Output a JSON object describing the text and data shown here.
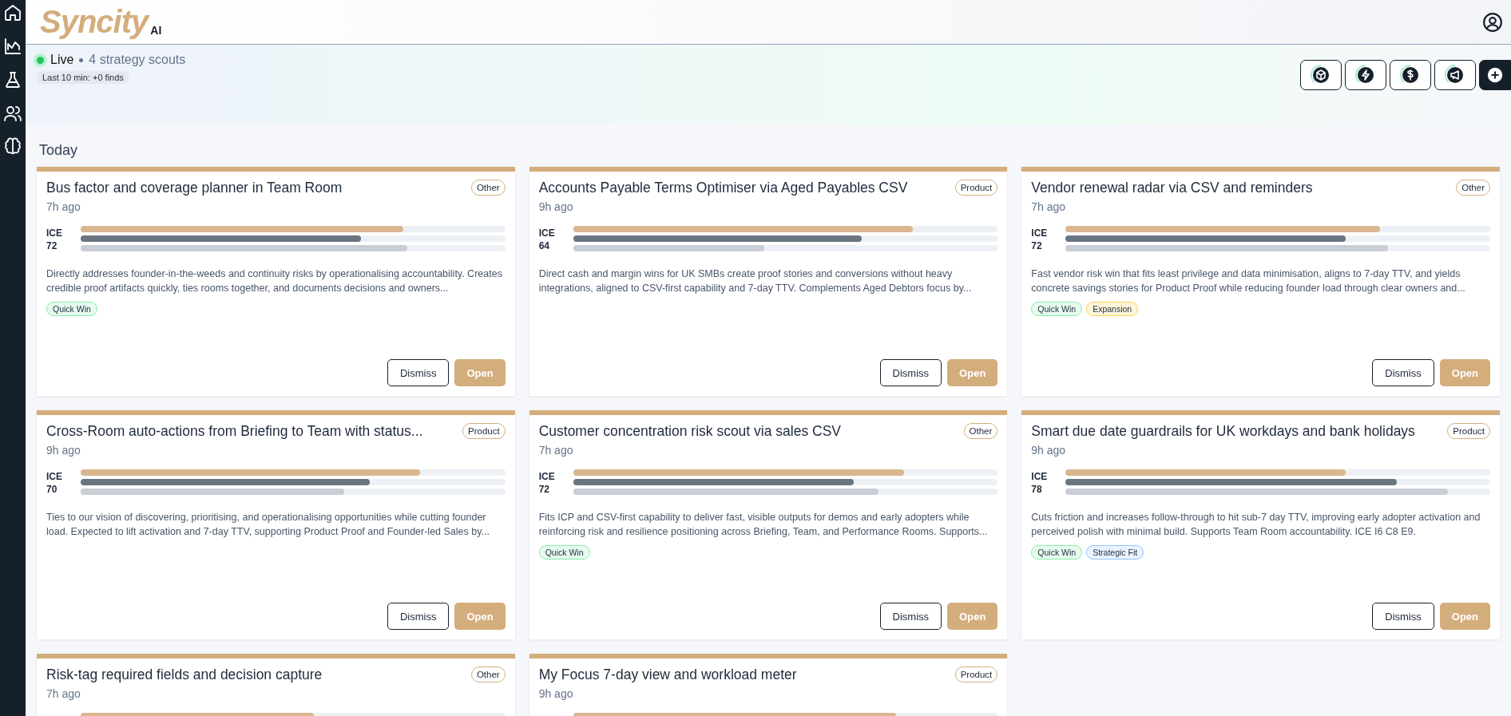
{
  "brand": {
    "name": "Syncity",
    "suffix": "AI"
  },
  "status": {
    "live": "Live",
    "scouts": "4 strategy scouts",
    "recent": "Last 10 min: +0 finds"
  },
  "section": "Today",
  "cards": [
    {
      "title": "Bus factor and coverage planner in Team Room",
      "category": "Other",
      "time": "7h ago",
      "ice_label": "ICE",
      "ice": "72",
      "bars": [
        {
          "level": 0.76
        },
        {
          "level": 0.66
        },
        {
          "level": 0.77
        }
      ],
      "description": "Directly addresses founder-in-the-weeds and continuity risks by operationalising accountability. Creates credible proof artifacts quickly, ties rooms together, and documents decisions and owners...",
      "tags": [
        {
          "label": "Quick Win",
          "color": "#86efac"
        }
      ],
      "actions": [
        "Dismiss",
        "Open"
      ]
    },
    {
      "title": "Accounts Payable Terms Optimiser via Aged Payables CSV",
      "category": "Product",
      "time": "9h ago",
      "ice_label": "ICE",
      "ice": "64",
      "bars": [
        {
          "level": 0.8
        },
        {
          "level": 0.68
        },
        {
          "level": 0.45
        }
      ],
      "description": "Direct cash and margin wins for UK SMBs create proof stories and conversions without heavy integrations, aligned to CSV-first capability and 7-day TTV. Complements Aged Debtors focus by...",
      "actions": [
        "Dismiss",
        "Open"
      ]
    },
    {
      "title": "Vendor renewal radar via CSV and reminders",
      "category": "Other",
      "time": "7h ago",
      "ice_label": "ICE",
      "ice": "72",
      "bars": [
        {
          "level": 0.74
        },
        {
          "level": 0.66
        },
        {
          "level": 0.76
        }
      ],
      "description": "Fast vendor risk win that fits least privilege and data minimisation, aligns to 7-day TTV, and yields concrete savings stories for Product Proof while reducing founder load through clear owners and...",
      "tags": [
        {
          "label": "Quick Win",
          "color": "#86efac"
        },
        {
          "label": "Expansion",
          "color": "#fcd34d"
        }
      ],
      "actions": [
        "Dismiss",
        "Open"
      ]
    },
    {
      "title": "Cross-Room auto-actions from Briefing to Team with status...",
      "category": "Product",
      "time": "9h ago",
      "ice_label": "ICE",
      "ice": "70",
      "bars": [
        {
          "level": 0.8
        },
        {
          "level": 0.68
        },
        {
          "level": 0.62
        }
      ],
      "description": "Ties to our vision of discovering, prioritising, and operationalising opportunities while cutting founder load. Expected to lift activation and 7-day TTV, supporting Product Proof and Founder-led Sales by...",
      "actions": [
        "Dismiss",
        "Open"
      ]
    },
    {
      "title": "Customer concentration risk scout via sales CSV",
      "category": "Other",
      "time": "7h ago",
      "ice_label": "ICE",
      "ice": "72",
      "bars": [
        {
          "level": 0.78
        },
        {
          "level": 0.66
        },
        {
          "level": 0.72
        }
      ],
      "description": "Fits ICP and CSV-first capability to deliver fast, visible outputs for demos and early adopters while reinforcing risk and resilience positioning across Briefing, Team, and Performance Rooms. Supports...",
      "tags": [
        {
          "label": "Quick Win",
          "color": "#86efac"
        }
      ],
      "actions": [
        "Dismiss",
        "Open"
      ]
    },
    {
      "title": "Smart due date guardrails for UK workdays and bank holidays",
      "category": "Product",
      "time": "9h ago",
      "ice_label": "ICE",
      "ice": "78",
      "bars": [
        {
          "level": 0.66
        },
        {
          "level": 0.78
        },
        {
          "level": 0.9
        }
      ],
      "description": "Cuts friction and increases follow-through to hit sub-7 day TTV, improving early adopter activation and perceived polish with minimal build. Supports Team Room accountability. ICE I6 C8 E9.",
      "tags": [
        {
          "label": "Quick Win",
          "color": "#86efac"
        },
        {
          "label": "Strategic Fit",
          "color": "#93c5fd"
        }
      ],
      "actions": [
        "Dismiss",
        "Open"
      ]
    },
    {
      "title": "Risk-tag required fields and decision capture",
      "category": "Other",
      "time": "7h ago",
      "bars": [
        {
          "level": 0.55
        }
      ]
    },
    {
      "title": "My Focus 7-day view and workload meter",
      "category": "Product",
      "time": "9h ago",
      "bars": [
        {
          "level": 0.76
        }
      ]
    }
  ],
  "toolbar": [
    {
      "kind": "box"
    },
    {
      "kind": "bolt"
    },
    {
      "kind": "dollar"
    },
    {
      "kind": "megaphone"
    },
    {
      "kind": "add"
    }
  ],
  "sidebar": [
    {
      "kind": "home"
    },
    {
      "kind": "chart"
    },
    {
      "kind": "flask"
    },
    {
      "kind": "users"
    },
    {
      "kind": "brain"
    }
  ]
}
